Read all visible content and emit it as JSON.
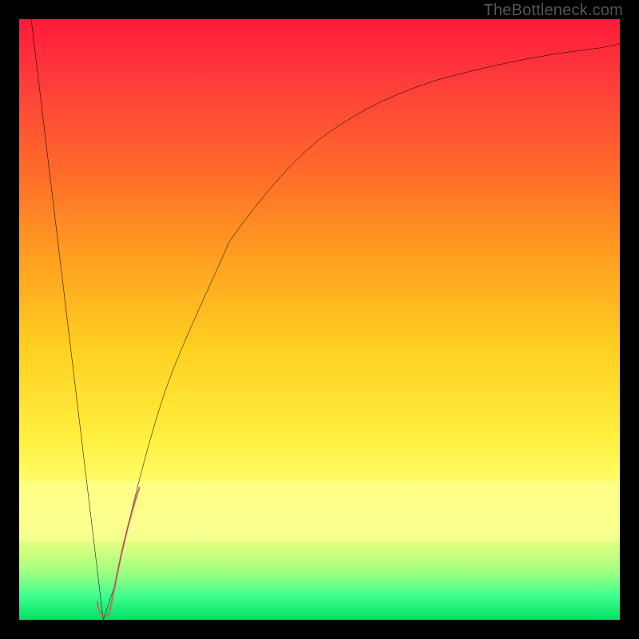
{
  "attribution": "TheBottleneck.com",
  "chart_data": {
    "type": "line",
    "title": "",
    "xlabel": "",
    "ylabel": "",
    "xlim": [
      0,
      100
    ],
    "ylim": [
      0,
      100
    ],
    "grid": false,
    "series": [
      {
        "name": "main-curve",
        "x": [
          2,
          14,
          16,
          20,
          25,
          30,
          35,
          40,
          50,
          60,
          70,
          80,
          90,
          100
        ],
        "y": [
          100,
          0,
          6,
          22,
          40,
          53,
          63,
          70,
          80,
          86,
          90,
          93,
          95,
          96
        ],
        "color": "#000000"
      },
      {
        "name": "highlight-segment",
        "x": [
          13,
          14,
          16,
          20
        ],
        "y": [
          3,
          0,
          6,
          22
        ],
        "color": "#cc6666"
      }
    ],
    "gradient_stops": [
      {
        "pos": 0,
        "color": "#ff1a3a"
      },
      {
        "pos": 10,
        "color": "#ff3b3b"
      },
      {
        "pos": 25,
        "color": "#ff6a2a"
      },
      {
        "pos": 40,
        "color": "#ffa020"
      },
      {
        "pos": 55,
        "color": "#ffd020"
      },
      {
        "pos": 70,
        "color": "#fff040"
      },
      {
        "pos": 78,
        "color": "#ffff70"
      },
      {
        "pos": 84,
        "color": "#f5ff80"
      },
      {
        "pos": 88,
        "color": "#d8ff80"
      },
      {
        "pos": 92,
        "color": "#a0ff80"
      },
      {
        "pos": 96,
        "color": "#40ff90"
      },
      {
        "pos": 100,
        "color": "#00e060"
      }
    ]
  }
}
